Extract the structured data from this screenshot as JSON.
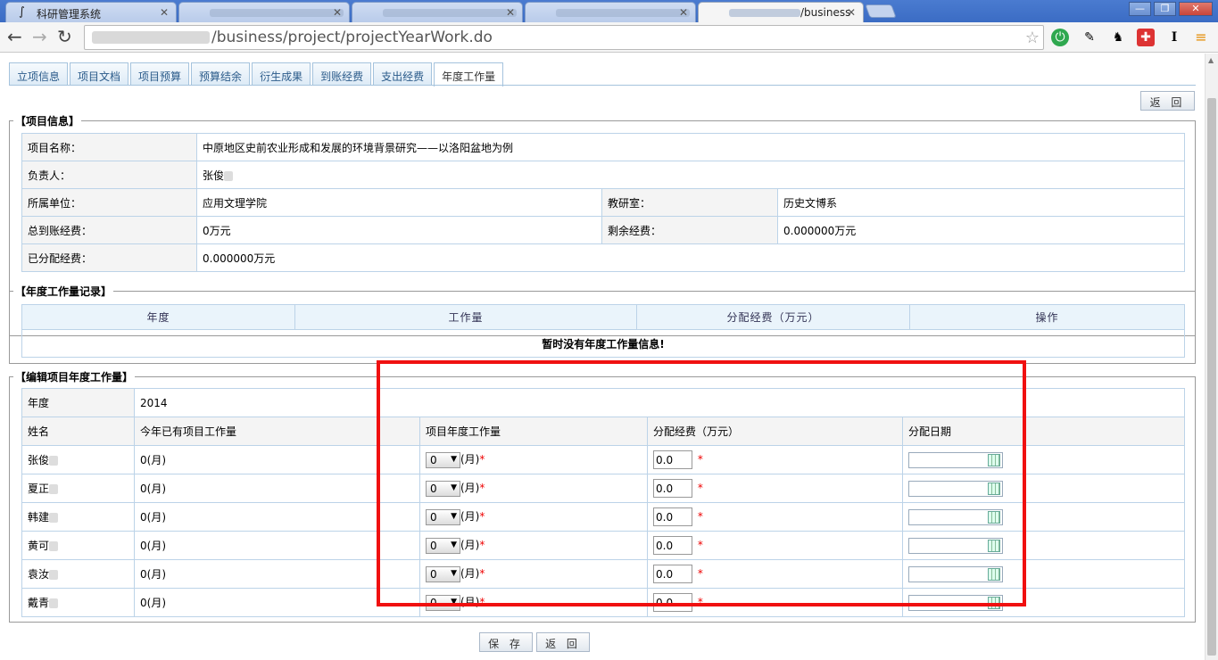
{
  "browser": {
    "tabs": [
      {
        "title": "科研管理系统",
        "active": false
      },
      {
        "title": "",
        "active": false
      },
      {
        "title": "",
        "active": false
      },
      {
        "title": "",
        "active": false
      },
      {
        "title": "/business",
        "active": true
      }
    ],
    "address": "/business/project/projectYearWork.do"
  },
  "page_tabs": [
    "立项信息",
    "项目文档",
    "项目预算",
    "预算结余",
    "衍生成果",
    "到账经费",
    "支出经费",
    "年度工作量"
  ],
  "return_top": "返 回",
  "project_info": {
    "legend": "【项目信息】",
    "name_label": "项目名称：",
    "name_value": "中原地区史前农业形成和发展的环境背景研究——以洛阳盆地为例",
    "leader_label": "负责人：",
    "leader_value": "张俊",
    "unit_label": "所属单位：",
    "unit_value": "应用文理学院",
    "dept_label": "教研室：",
    "dept_value": "历史文博系",
    "total_label": "总到账经费：",
    "total_value": "0万元",
    "remain_label": "剩余经费：",
    "remain_value": "0.000000万元",
    "allocated_label": "已分配经费：",
    "allocated_value": "0.000000万元"
  },
  "records": {
    "legend": "【年度工作量记录】",
    "headers": [
      "年度",
      "工作量",
      "分配经费（万元）",
      "操作"
    ],
    "empty": "暂时没有年度工作量信息!"
  },
  "edit": {
    "legend": "【编辑项目年度工作量】",
    "year_label": "年度",
    "year_value": "2014",
    "headers": [
      "姓名",
      "今年已有项目工作量",
      "项目年度工作量",
      "分配经费（万元）",
      "分配日期"
    ],
    "unit": "(月)",
    "req": "*",
    "rows": [
      {
        "name": "张俊",
        "existing": "0(月)",
        "workload": "0",
        "fee": "0.0",
        "date": ""
      },
      {
        "name": "夏正",
        "existing": "0(月)",
        "workload": "0",
        "fee": "0.0",
        "date": ""
      },
      {
        "name": "韩建",
        "existing": "0(月)",
        "workload": "0",
        "fee": "0.0",
        "date": ""
      },
      {
        "name": "黄可",
        "existing": "0(月)",
        "workload": "0",
        "fee": "0.0",
        "date": ""
      },
      {
        "name": "袁汝",
        "existing": "0(月)",
        "workload": "0",
        "fee": "0.0",
        "date": ""
      },
      {
        "name": "戴青",
        "existing": "0(月)",
        "workload": "0",
        "fee": "0.0",
        "date": ""
      }
    ]
  },
  "save": "保 存",
  "return_bottom": "返 回"
}
